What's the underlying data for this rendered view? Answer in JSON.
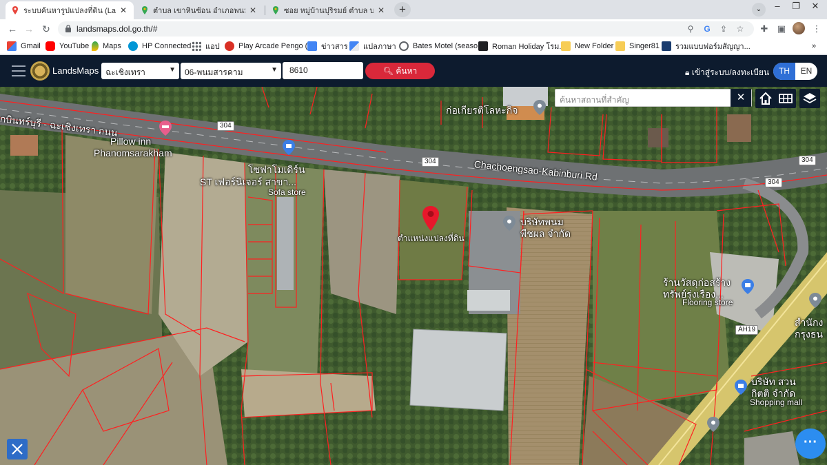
{
  "browser": {
    "tabs": [
      {
        "title": "ระบบค้นหารูปแปลงที่ดิน (LandsMa"
      },
      {
        "title": "ตำบล เขาหินซ้อน อำเภอพนมสารค"
      },
      {
        "title": "ซอย หมู่บ้านปุริรมย์ ตำบล บางน้ำจืด"
      }
    ],
    "url": "landsmaps.dol.go.th/#",
    "bookmarks": [
      {
        "label": "Gmail",
        "icon": "gmail-icon",
        "color": "#d93025"
      },
      {
        "label": "YouTube",
        "icon": "youtube-icon",
        "color": "#ff0000"
      },
      {
        "label": "Maps",
        "icon": "maps-icon",
        "color": "#34a853"
      },
      {
        "label": "HP Connected",
        "icon": "hp-icon",
        "color": "#0096d6"
      },
      {
        "label": "แอป",
        "icon": "apps-grid-icon",
        "color": "#5f6368"
      },
      {
        "label": "Play Arcade Pengo (...",
        "icon": "arcade-icon",
        "color": "#d93025"
      },
      {
        "label": "ข่าวสาร",
        "icon": "news-icon",
        "color": "#4285f4"
      },
      {
        "label": "แปลภาษา",
        "icon": "translate-icon",
        "color": "#4285f4"
      },
      {
        "label": "Bates Motel (seaso...",
        "icon": "globe-icon",
        "color": "#5f6368"
      },
      {
        "label": "Roman Holiday โรม...",
        "icon": "film-icon",
        "color": "#202124"
      },
      {
        "label": "New Folder",
        "icon": "folder-icon",
        "color": "#f7cd56"
      },
      {
        "label": "Singer81",
        "icon": "folder-icon",
        "color": "#f7cd56"
      },
      {
        "label": "รวมแบบฟอร์มสัญญา...",
        "icon": "doc-icon",
        "color": "#1a3c6e"
      }
    ]
  },
  "app": {
    "brand": "LandsMaps",
    "district": "ฉะเชิงเทรา",
    "amphoe": "06-พนมสารคาม",
    "parcel_number": "8610",
    "search_label": "ค้นหา",
    "login_label": "เข้าสู่ระบบ/ลงทะเบียน",
    "lang_th": "TH",
    "lang_en": "EN",
    "accent": "#d9283a",
    "header_bg": "#0d1b2e"
  },
  "map": {
    "place_search_placeholder": "ค้นหาสถานที่สำคัญ",
    "labels": {
      "road_main": "Chachoengsao-Kabinburi Rd",
      "road_thai": "กบินทร์บุรี - ฉะเชิงเทรา ถนน",
      "pillow1": "Pillow inn",
      "pillow2": "Phanomsarakham",
      "sofa1": "โซฟาโมเดิร์น",
      "sofa2": "ST เฟอร์นิเจอร์ สาขา...",
      "sofa3": "Sofa store",
      "ko_kiat": "ก่อเกียรติโลหะกิจ",
      "parcel_pin": "ตำแหน่งแปลงที่ดิน",
      "company1": "บริษัทพนม",
      "company2": "พืชผล จำกัด",
      "store1": "ร้านวัสดุก่อสร้าง",
      "store2": "ทรัพย์รุ่งเรือง...",
      "store3": "Flooring store",
      "station1": "สำนักง",
      "station2": "กรุงธน",
      "mall1": "บริษัท สวน",
      "mall2": "กิตติ จำกัด",
      "mall3": "Shopping mall",
      "route_304": "304",
      "route_ah19": "AH19"
    }
  }
}
